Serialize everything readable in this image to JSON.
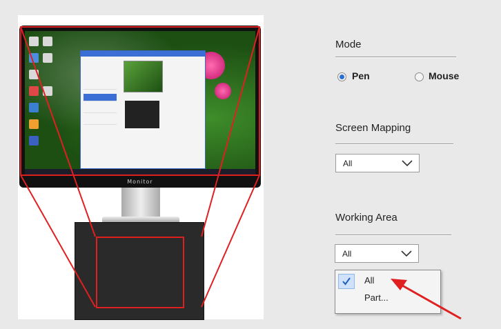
{
  "illustration": {
    "monitor_brand": "Monitor"
  },
  "mode": {
    "label": "Mode",
    "options": [
      {
        "label": "Pen",
        "selected": true
      },
      {
        "label": "Mouse",
        "selected": false
      }
    ]
  },
  "screen_mapping": {
    "label": "Screen Mapping",
    "value": "All"
  },
  "working_area": {
    "label": "Working Area",
    "value": "All",
    "dropdown_options": [
      {
        "label": "All",
        "checked": true
      },
      {
        "label": "Part...",
        "checked": false
      }
    ]
  },
  "colors": {
    "highlight": "#e02020",
    "accent": "#2a6fd6"
  },
  "icons": [
    "chevron-down-icon",
    "checkmark-icon",
    "red-arrow-annotation"
  ]
}
